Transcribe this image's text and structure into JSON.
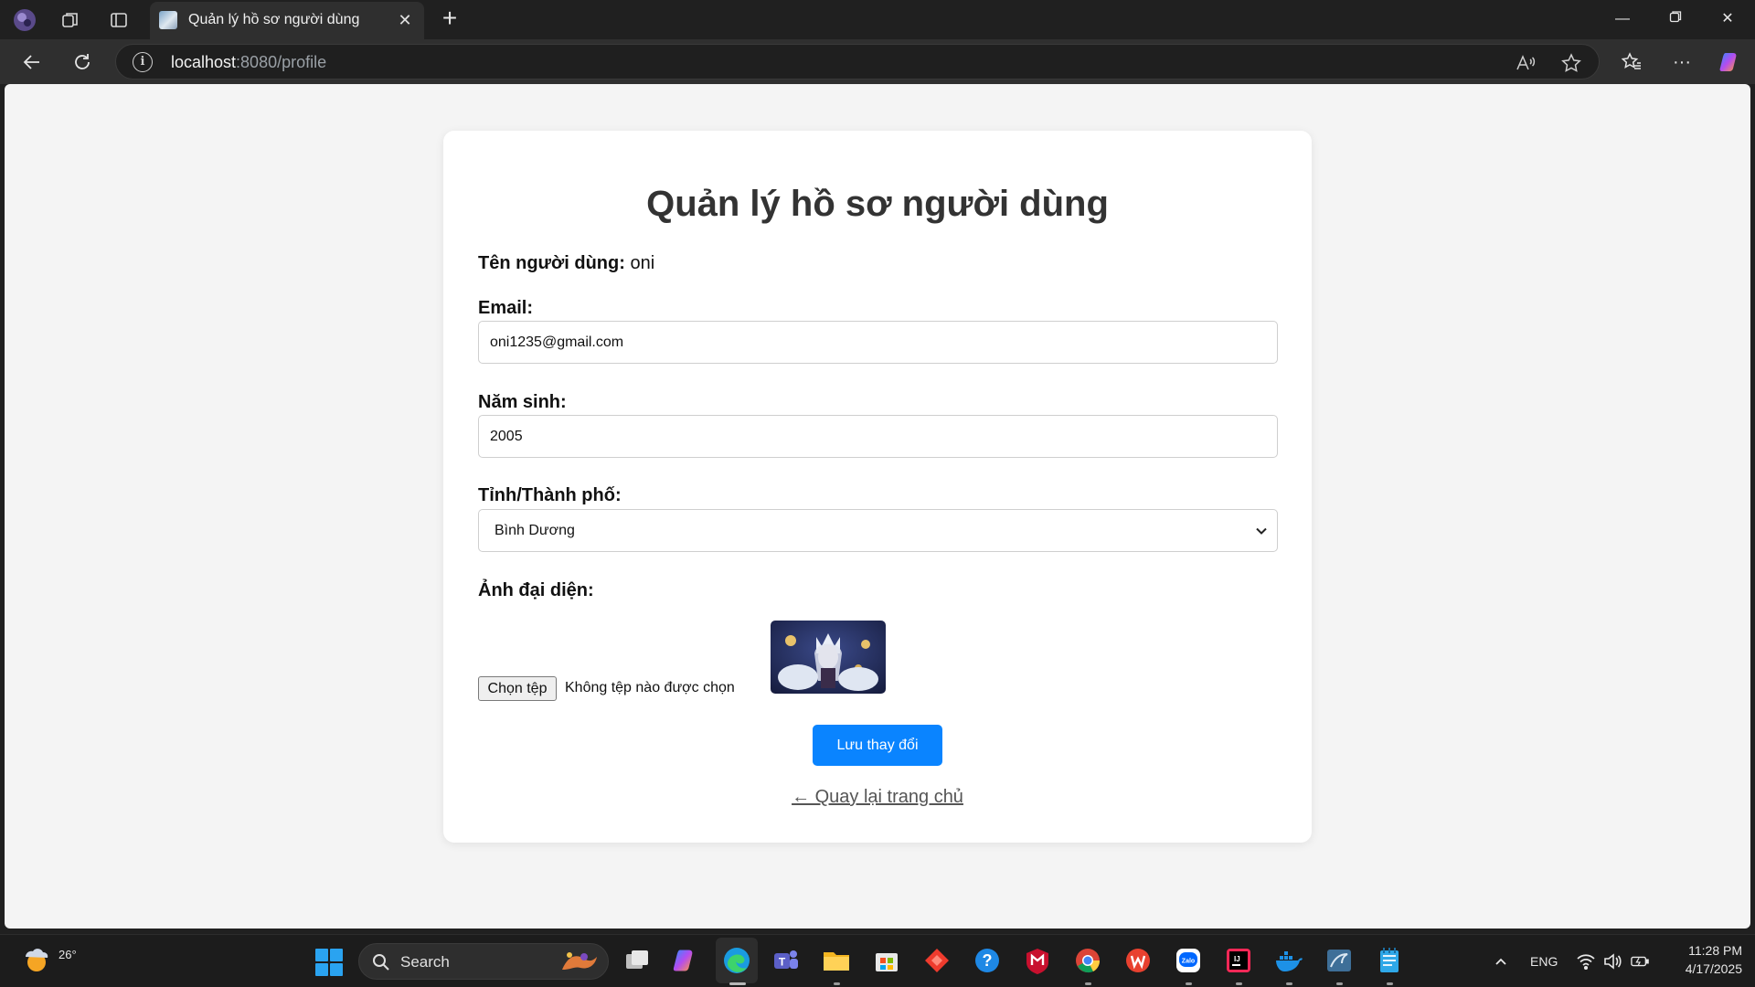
{
  "browser": {
    "tab_title": "Quản lý hồ sơ người dùng",
    "url_host": "localhost",
    "url_rest": ":8080/profile"
  },
  "page": {
    "heading": "Quản lý hồ sơ người dùng",
    "username_label": "Tên người dùng:",
    "username_value": "oni",
    "email_label": "Email:",
    "email_value": "oni1235@gmail.com",
    "birth_year_label": "Năm sinh:",
    "birth_year_value": "2005",
    "city_label": "Tỉnh/Thành phố:",
    "city_selected": "Bình Dương",
    "avatar_label": "Ảnh đại diện:",
    "file_button_label": "Chọn tệp",
    "file_status": "Không tệp nào được chọn",
    "save_button_label": "Lưu thay đổi",
    "back_link_label": "← Quay lại trang chủ"
  },
  "taskbar": {
    "weather_temp": "26°",
    "search_placeholder": "Search",
    "language": "ENG",
    "time": "11:28 PM",
    "date": "4/17/2025"
  },
  "colors": {
    "accent": "#0a84ff",
    "card_bg": "#ffffff",
    "page_bg": "#f4f4f4",
    "chrome_bg": "#202020"
  }
}
